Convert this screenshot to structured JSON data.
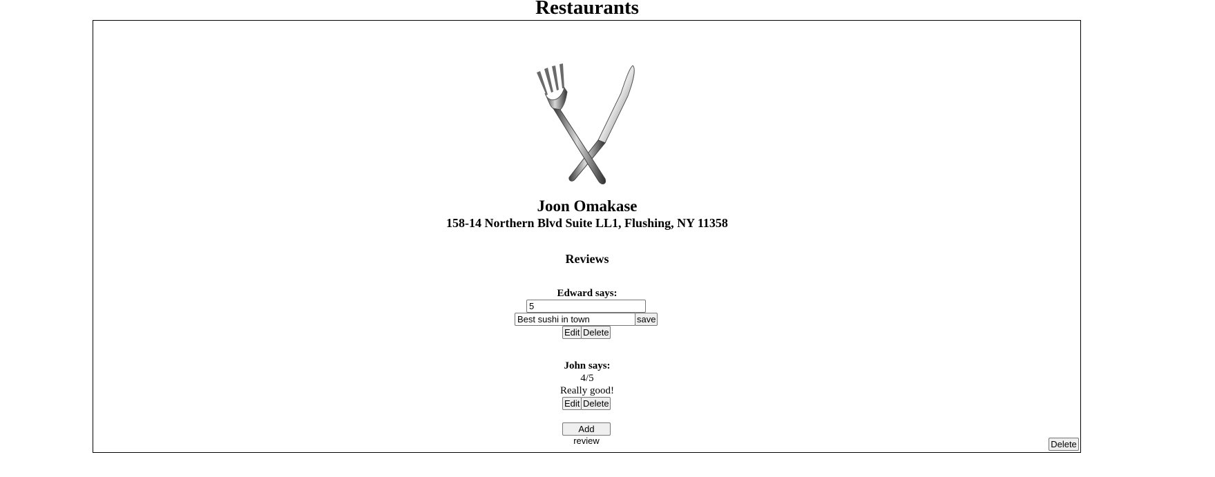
{
  "page": {
    "title": "Restaurants"
  },
  "restaurant": {
    "logo_icon": "fork-and-knife-icon",
    "name": "Joon Omakase",
    "address": "158-14 Northern Blvd Suite LL1, Flushing, NY 11358",
    "delete_label": "Delete"
  },
  "reviews": {
    "heading": "Reviews",
    "items": [
      {
        "author_line": "Edward says:",
        "editing": true,
        "rating_value": "5",
        "comment_value": "Best sushi in town",
        "save_label": "save",
        "edit_label": "Edit",
        "delete_label": "Delete"
      },
      {
        "author_line": "John says:",
        "editing": false,
        "rating_text": "4/5",
        "comment_text": "Really good!",
        "edit_label": "Edit",
        "delete_label": "Delete"
      }
    ],
    "add_label": "Add review"
  }
}
